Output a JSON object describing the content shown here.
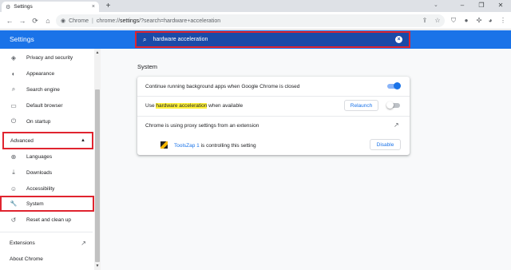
{
  "browser": {
    "tab_title": "Settings",
    "tab_close": "×",
    "new_tab": "+",
    "window_controls": {
      "minimize": "–",
      "maximize": "❐",
      "close": "✕"
    },
    "nav": {
      "back": "←",
      "forward": "→",
      "reload": "⟳",
      "home": "⌂"
    },
    "omnibox": {
      "site_chip": "Chrome",
      "separator": "|",
      "url_scheme": "chrome://",
      "url_host": "settings",
      "url_rest": "/?search=hardware+acceleration"
    }
  },
  "header": {
    "title": "Settings",
    "search": {
      "value": "hardware acceleration"
    }
  },
  "sidebar": {
    "items_top": [
      {
        "label": "Privacy and security",
        "icon": "shield-icon",
        "glyph": "◈"
      },
      {
        "label": "Appearance",
        "icon": "palette-icon",
        "glyph": "◐"
      },
      {
        "label": "Search engine",
        "icon": "search-icon",
        "glyph": "⌕"
      },
      {
        "label": "Default browser",
        "icon": "browser-icon",
        "glyph": "▭"
      },
      {
        "label": "On startup",
        "icon": "power-icon",
        "glyph": "⏻"
      }
    ],
    "advanced_label": "Advanced",
    "advanced_caret": "▲",
    "items_advanced": [
      {
        "label": "Languages",
        "icon": "globe-icon",
        "glyph": "⊕"
      },
      {
        "label": "Downloads",
        "icon": "download-icon",
        "glyph": "⤓"
      },
      {
        "label": "Accessibility",
        "icon": "accessibility-icon",
        "glyph": "☺"
      },
      {
        "label": "System",
        "icon": "wrench-icon",
        "glyph": "🔧"
      },
      {
        "label": "Reset and clean up",
        "icon": "history-icon",
        "glyph": "↺"
      }
    ],
    "extensions_label": "Extensions",
    "extensions_icon": "↗",
    "about_label": "About Chrome"
  },
  "main": {
    "section_title": "System",
    "rows": {
      "background_apps": "Continue running background apps when Google Chrome is closed",
      "hw_prefix": "Use ",
      "hw_highlight": "hardware acceleration",
      "hw_suffix": " when available",
      "relaunch_label": "Relaunch",
      "proxy": "Chrome is using proxy settings from an extension",
      "ext_name": "ToolsZap 1",
      "ext_controlling": " is controlling this setting",
      "disable_label": "Disable"
    },
    "toggles": {
      "background_apps_on": true,
      "hw_accel_on": false
    }
  },
  "colors": {
    "accent": "#1a73e8",
    "highlight": "#fff23b",
    "annotation_red": "#e0242f"
  }
}
